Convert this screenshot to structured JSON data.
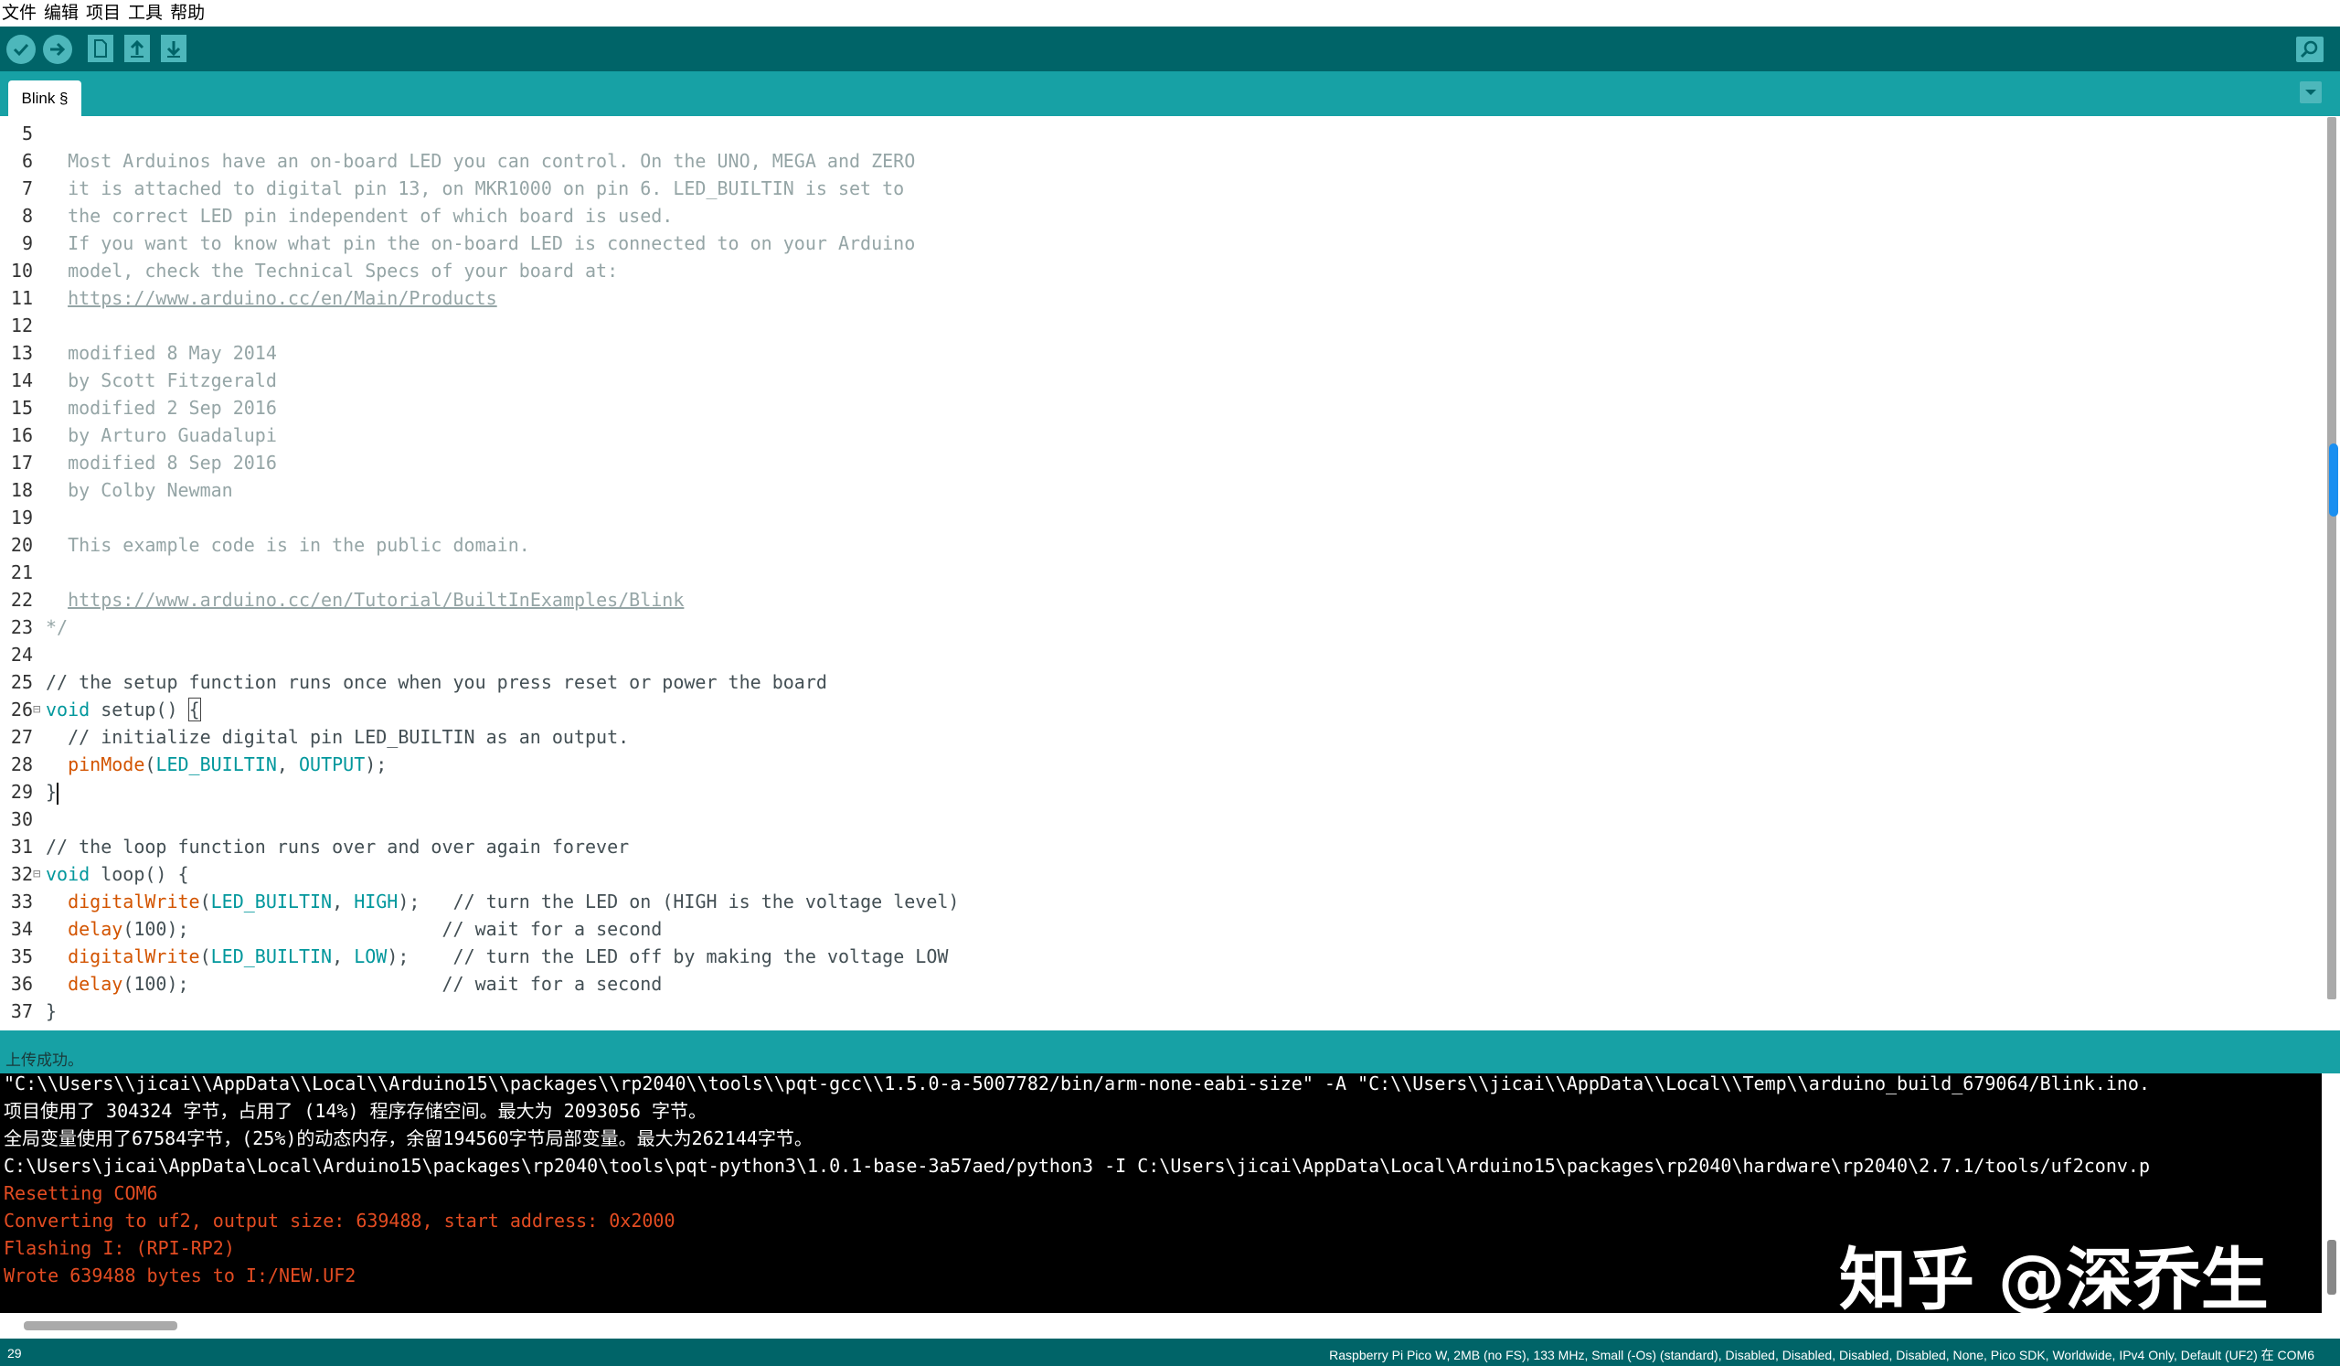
{
  "menu": [
    "文件",
    "编辑",
    "项目",
    "工具",
    "帮助"
  ],
  "tab": {
    "label": "Blink §"
  },
  "editor": {
    "lines": [
      {
        "n": "5",
        "segs": []
      },
      {
        "n": "6",
        "segs": [
          {
            "t": "  Most Arduinos have an on-board LED you can control. On the UNO, MEGA and ZERO",
            "c": "comment"
          }
        ]
      },
      {
        "n": "7",
        "segs": [
          {
            "t": "  it is attached to digital pin 13, on MKR1000 on pin 6. LED_BUILTIN is set to",
            "c": "comment"
          }
        ]
      },
      {
        "n": "8",
        "segs": [
          {
            "t": "  the correct LED pin independent of which board is used.",
            "c": "comment"
          }
        ]
      },
      {
        "n": "9",
        "segs": [
          {
            "t": "  If you want to know what pin the on-board LED is connected to on your Arduino",
            "c": "comment"
          }
        ]
      },
      {
        "n": "10",
        "segs": [
          {
            "t": "  model, check the Technical Specs of your board at:",
            "c": "comment"
          }
        ]
      },
      {
        "n": "11",
        "segs": [
          {
            "t": "  ",
            "c": "comment"
          },
          {
            "t": "https://www.arduino.cc/en/Main/Products",
            "c": "link"
          }
        ]
      },
      {
        "n": "12",
        "segs": []
      },
      {
        "n": "13",
        "segs": [
          {
            "t": "  modified 8 May 2014",
            "c": "comment"
          }
        ]
      },
      {
        "n": "14",
        "segs": [
          {
            "t": "  by Scott Fitzgerald",
            "c": "comment"
          }
        ]
      },
      {
        "n": "15",
        "segs": [
          {
            "t": "  modified 2 Sep 2016",
            "c": "comment"
          }
        ]
      },
      {
        "n": "16",
        "segs": [
          {
            "t": "  by Arturo Guadalupi",
            "c": "comment"
          }
        ]
      },
      {
        "n": "17",
        "segs": [
          {
            "t": "  modified 8 Sep 2016",
            "c": "comment"
          }
        ]
      },
      {
        "n": "18",
        "segs": [
          {
            "t": "  by Colby Newman",
            "c": "comment"
          }
        ]
      },
      {
        "n": "19",
        "segs": []
      },
      {
        "n": "20",
        "segs": [
          {
            "t": "  This example code is in the public domain.",
            "c": "comment"
          }
        ]
      },
      {
        "n": "21",
        "segs": []
      },
      {
        "n": "22",
        "segs": [
          {
            "t": "  ",
            "c": "comment"
          },
          {
            "t": "https://www.arduino.cc/en/Tutorial/BuiltInExamples/Blink",
            "c": "link"
          }
        ]
      },
      {
        "n": "23",
        "segs": [
          {
            "t": "*/",
            "c": "comment"
          }
        ]
      },
      {
        "n": "24",
        "segs": []
      },
      {
        "n": "25",
        "segs": [
          {
            "t": "// the setup function runs once when you press reset or power the board",
            "c": "linecmt"
          }
        ]
      },
      {
        "n": "26",
        "fold": true,
        "segs": [
          {
            "t": "void",
            "c": "kw"
          },
          {
            "t": " ",
            "c": "plain"
          },
          {
            "t": "setup",
            "c": "fn2"
          },
          {
            "t": "() ",
            "c": "plain"
          },
          {
            "t": "{",
            "c": "brace"
          }
        ]
      },
      {
        "n": "27",
        "segs": [
          {
            "t": "  // initialize digital pin LED_BUILTIN as an output.",
            "c": "linecmt"
          }
        ]
      },
      {
        "n": "28",
        "segs": [
          {
            "t": "  ",
            "c": "plain"
          },
          {
            "t": "pinMode",
            "c": "fn"
          },
          {
            "t": "(",
            "c": "plain"
          },
          {
            "t": "LED_BUILTIN",
            "c": "const"
          },
          {
            "t": ", ",
            "c": "plain"
          },
          {
            "t": "OUTPUT",
            "c": "const"
          },
          {
            "t": ");",
            "c": "plain"
          }
        ]
      },
      {
        "n": "29",
        "segs": [
          {
            "t": "}",
            "c": "plain"
          },
          {
            "t": "",
            "c": "caret"
          }
        ]
      },
      {
        "n": "30",
        "segs": []
      },
      {
        "n": "31",
        "segs": [
          {
            "t": "// the loop function runs over and over again forever",
            "c": "linecmt"
          }
        ]
      },
      {
        "n": "32",
        "fold": true,
        "segs": [
          {
            "t": "void",
            "c": "kw"
          },
          {
            "t": " ",
            "c": "plain"
          },
          {
            "t": "loop",
            "c": "fn2"
          },
          {
            "t": "() {",
            "c": "plain"
          }
        ]
      },
      {
        "n": "33",
        "segs": [
          {
            "t": "  ",
            "c": "plain"
          },
          {
            "t": "digitalWrite",
            "c": "fn"
          },
          {
            "t": "(",
            "c": "plain"
          },
          {
            "t": "LED_BUILTIN",
            "c": "const"
          },
          {
            "t": ", ",
            "c": "plain"
          },
          {
            "t": "HIGH",
            "c": "const"
          },
          {
            "t": ");   // turn the LED on (HIGH is the voltage level)",
            "c": "plain"
          }
        ]
      },
      {
        "n": "34",
        "segs": [
          {
            "t": "  ",
            "c": "plain"
          },
          {
            "t": "delay",
            "c": "fn"
          },
          {
            "t": "(100);                       // wait for a second",
            "c": "plain"
          }
        ]
      },
      {
        "n": "35",
        "segs": [
          {
            "t": "  ",
            "c": "plain"
          },
          {
            "t": "digitalWrite",
            "c": "fn"
          },
          {
            "t": "(",
            "c": "plain"
          },
          {
            "t": "LED_BUILTIN",
            "c": "const"
          },
          {
            "t": ", ",
            "c": "plain"
          },
          {
            "t": "LOW",
            "c": "const"
          },
          {
            "t": ");    // turn the LED off by making the voltage LOW",
            "c": "plain"
          }
        ]
      },
      {
        "n": "36",
        "segs": [
          {
            "t": "  ",
            "c": "plain"
          },
          {
            "t": "delay",
            "c": "fn"
          },
          {
            "t": "(100);                       // wait for a second",
            "c": "plain"
          }
        ]
      },
      {
        "n": "37",
        "segs": [
          {
            "t": "}",
            "c": "plain"
          }
        ]
      }
    ]
  },
  "status": {
    "message": "上传成功。"
  },
  "console": {
    "lines": [
      {
        "t": "\"C:\\\\Users\\\\jicai\\\\AppData\\\\Local\\\\Arduino15\\\\packages\\\\rp2040\\\\tools\\\\pqt-gcc\\\\1.5.0-a-5007782/bin/arm-none-eabi-size\" -A \"C:\\\\Users\\\\jicai\\\\AppData\\\\Local\\\\Temp\\\\arduino_build_679064/Blink.ino.",
        "red": false
      },
      {
        "t": "项目使用了 304324 字节，占用了 (14%) 程序存储空间。最大为 2093056 字节。",
        "red": false
      },
      {
        "t": "全局变量使用了67584字节，(25%)的动态内存，余留194560字节局部变量。最大为262144字节。",
        "red": false
      },
      {
        "t": "C:\\Users\\jicai\\AppData\\Local\\Arduino15\\packages\\rp2040\\tools\\pqt-python3\\1.0.1-base-3a57aed/python3 -I C:\\Users\\jicai\\AppData\\Local\\Arduino15\\packages\\rp2040\\hardware\\rp2040\\2.7.1/tools/uf2conv.p",
        "red": false
      },
      {
        "t": "Resetting COM6",
        "red": true
      },
      {
        "t": "Converting to uf2, output size: 639488, start address: 0x2000",
        "red": true
      },
      {
        "t": "Flashing I: (RPI-RP2)",
        "red": true
      },
      {
        "t": "Wrote 639488 bytes to I:/NEW.UF2",
        "red": true
      }
    ]
  },
  "watermark": "知乎 @深乔生",
  "footer": {
    "line": "29",
    "board": "Raspberry Pi Pico W, 2MB (no FS), 133 MHz, Small (-Os) (standard), Disabled, Disabled, Disabled, Disabled, None, Pico SDK, Worldwide, IPv4 Only, Default (UF2) 在 COM6"
  },
  "colors": {
    "toolbar": "#006468",
    "tabrow": "#17a1a5",
    "button": "#4db7bb",
    "console_error": "#e34c22"
  }
}
